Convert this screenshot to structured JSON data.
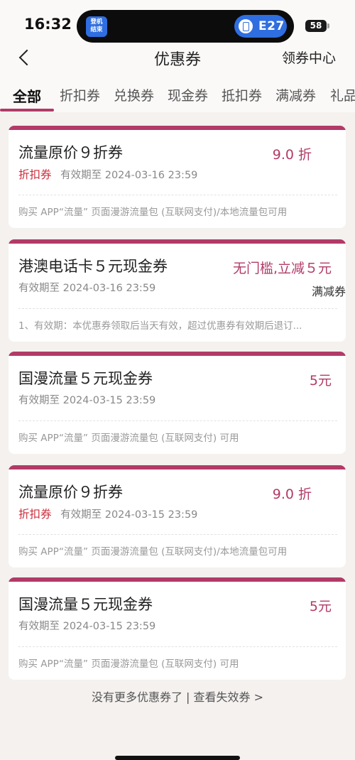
{
  "status_bar": {
    "time": "16:32",
    "island_badge": "登机\n结束",
    "gate": "E27",
    "battery": "58"
  },
  "header": {
    "title": "优惠券",
    "right_link": "领券中心"
  },
  "tabs": [
    {
      "label": "全部",
      "active": true
    },
    {
      "label": "折扣券",
      "active": false
    },
    {
      "label": "兑换券",
      "active": false
    },
    {
      "label": "现金券",
      "active": false
    },
    {
      "label": "抵扣券",
      "active": false
    },
    {
      "label": "满减券",
      "active": false
    },
    {
      "label": "礼品",
      "active": false
    }
  ],
  "coupons": [
    {
      "name": "流量原价９折券",
      "amount": "9.0 折",
      "tag": "折扣券",
      "validity": "有效期至 2024-03-16 23:59",
      "type_right": "",
      "desc": "购买 APP“流量” 页面漫游流量包 (互联网支付)/本地流量包可用"
    },
    {
      "name": "港澳电话卡５元现金券",
      "amount": "无门槛,立减５元",
      "tag": "",
      "validity": "有效期至 2024-03-16 23:59",
      "type_right": "满减券",
      "desc": "1、有效期：本优惠券领取后当天有效，超过优惠券有效期后退订..."
    },
    {
      "name": "国漫流量５元现金券",
      "amount": "5元",
      "tag": "",
      "validity": "有效期至 2024-03-15 23:59",
      "type_right": "",
      "desc": "购买 APP“流量” 页面漫游流量包 (互联网支付) 可用"
    },
    {
      "name": "流量原价９折券",
      "amount": "9.0 折",
      "tag": "折扣券",
      "validity": "有效期至 2024-03-15 23:59",
      "type_right": "",
      "desc": "购买 APP“流量” 页面漫游流量包 (互联网支付)/本地流量包可用"
    },
    {
      "name": "国漫流量５元现金券",
      "amount": "5元",
      "tag": "",
      "validity": "有效期至 2024-03-15 23:59",
      "type_right": "",
      "desc": "购买 APP“流量” 页面漫游流量包 (互联网支付) 可用"
    }
  ],
  "footer": {
    "note": "没有更多优惠券了 | 查看失效券 >"
  },
  "colors": {
    "accent": "#b23a67",
    "tag_red": "#cc2a3a",
    "island_blue": "#2f6ee0"
  }
}
